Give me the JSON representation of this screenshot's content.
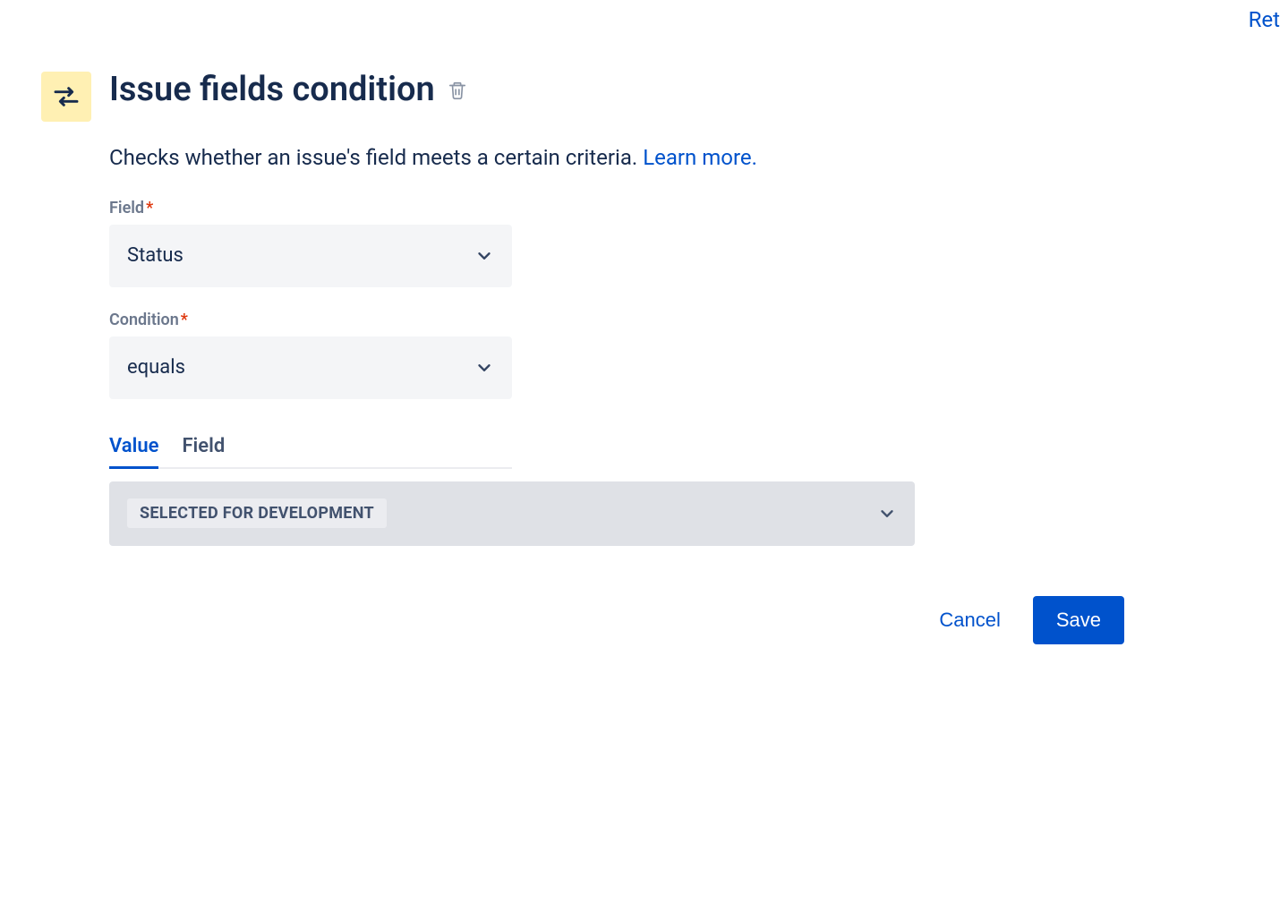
{
  "topLink": "Ret",
  "header": {
    "title": "Issue fields condition"
  },
  "description": {
    "text": "Checks whether an issue's field meets a certain criteria. ",
    "link": "Learn more."
  },
  "form": {
    "field": {
      "label": "Field",
      "required": "*",
      "value": "Status"
    },
    "condition": {
      "label": "Condition",
      "required": "*",
      "value": "equals"
    },
    "tabs": {
      "value": "Value",
      "field": "Field"
    },
    "valueSelect": "SELECTED FOR DEVELOPMENT"
  },
  "buttons": {
    "cancel": "Cancel",
    "save": "Save"
  }
}
